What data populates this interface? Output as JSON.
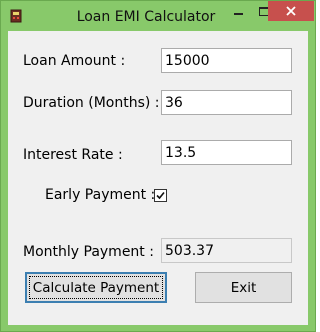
{
  "window": {
    "title": "Loan EMI Calculator",
    "frame_color": "#88c96a",
    "close_color": "#c7504d",
    "icons": [
      "app-icon",
      "minimize-icon",
      "maximize-icon",
      "close-icon"
    ]
  },
  "form": {
    "loan_amount": {
      "label": "Loan Amount :",
      "value": "15000"
    },
    "duration": {
      "label": "Duration (Months) :",
      "value": "36"
    },
    "interest_rate": {
      "label": "Interest Rate :",
      "value": "13.5"
    },
    "early_payment": {
      "label": "Early Payment :",
      "checked": true
    },
    "monthly_payment": {
      "label": "Monthly Payment :",
      "value": "503.37"
    }
  },
  "buttons": {
    "calculate": "Calculate Payment",
    "exit": "Exit"
  }
}
